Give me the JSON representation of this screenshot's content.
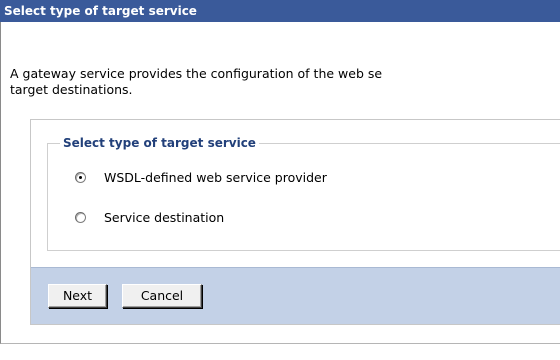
{
  "header": {
    "title": "Select type of target service"
  },
  "description": {
    "line1": "A gateway service provides the configuration of the web se",
    "line2": "target destinations."
  },
  "target_type": {
    "legend": "Select type of target service",
    "options": [
      {
        "label": "WSDL-defined web service provider",
        "selected": true
      },
      {
        "label": "Service destination",
        "selected": false
      }
    ]
  },
  "buttons": {
    "next": "Next",
    "cancel": "Cancel"
  },
  "colors": {
    "titlebar": "#3a5a9a",
    "legend_text": "#22407a",
    "button_bar": "#c3d1e7"
  }
}
